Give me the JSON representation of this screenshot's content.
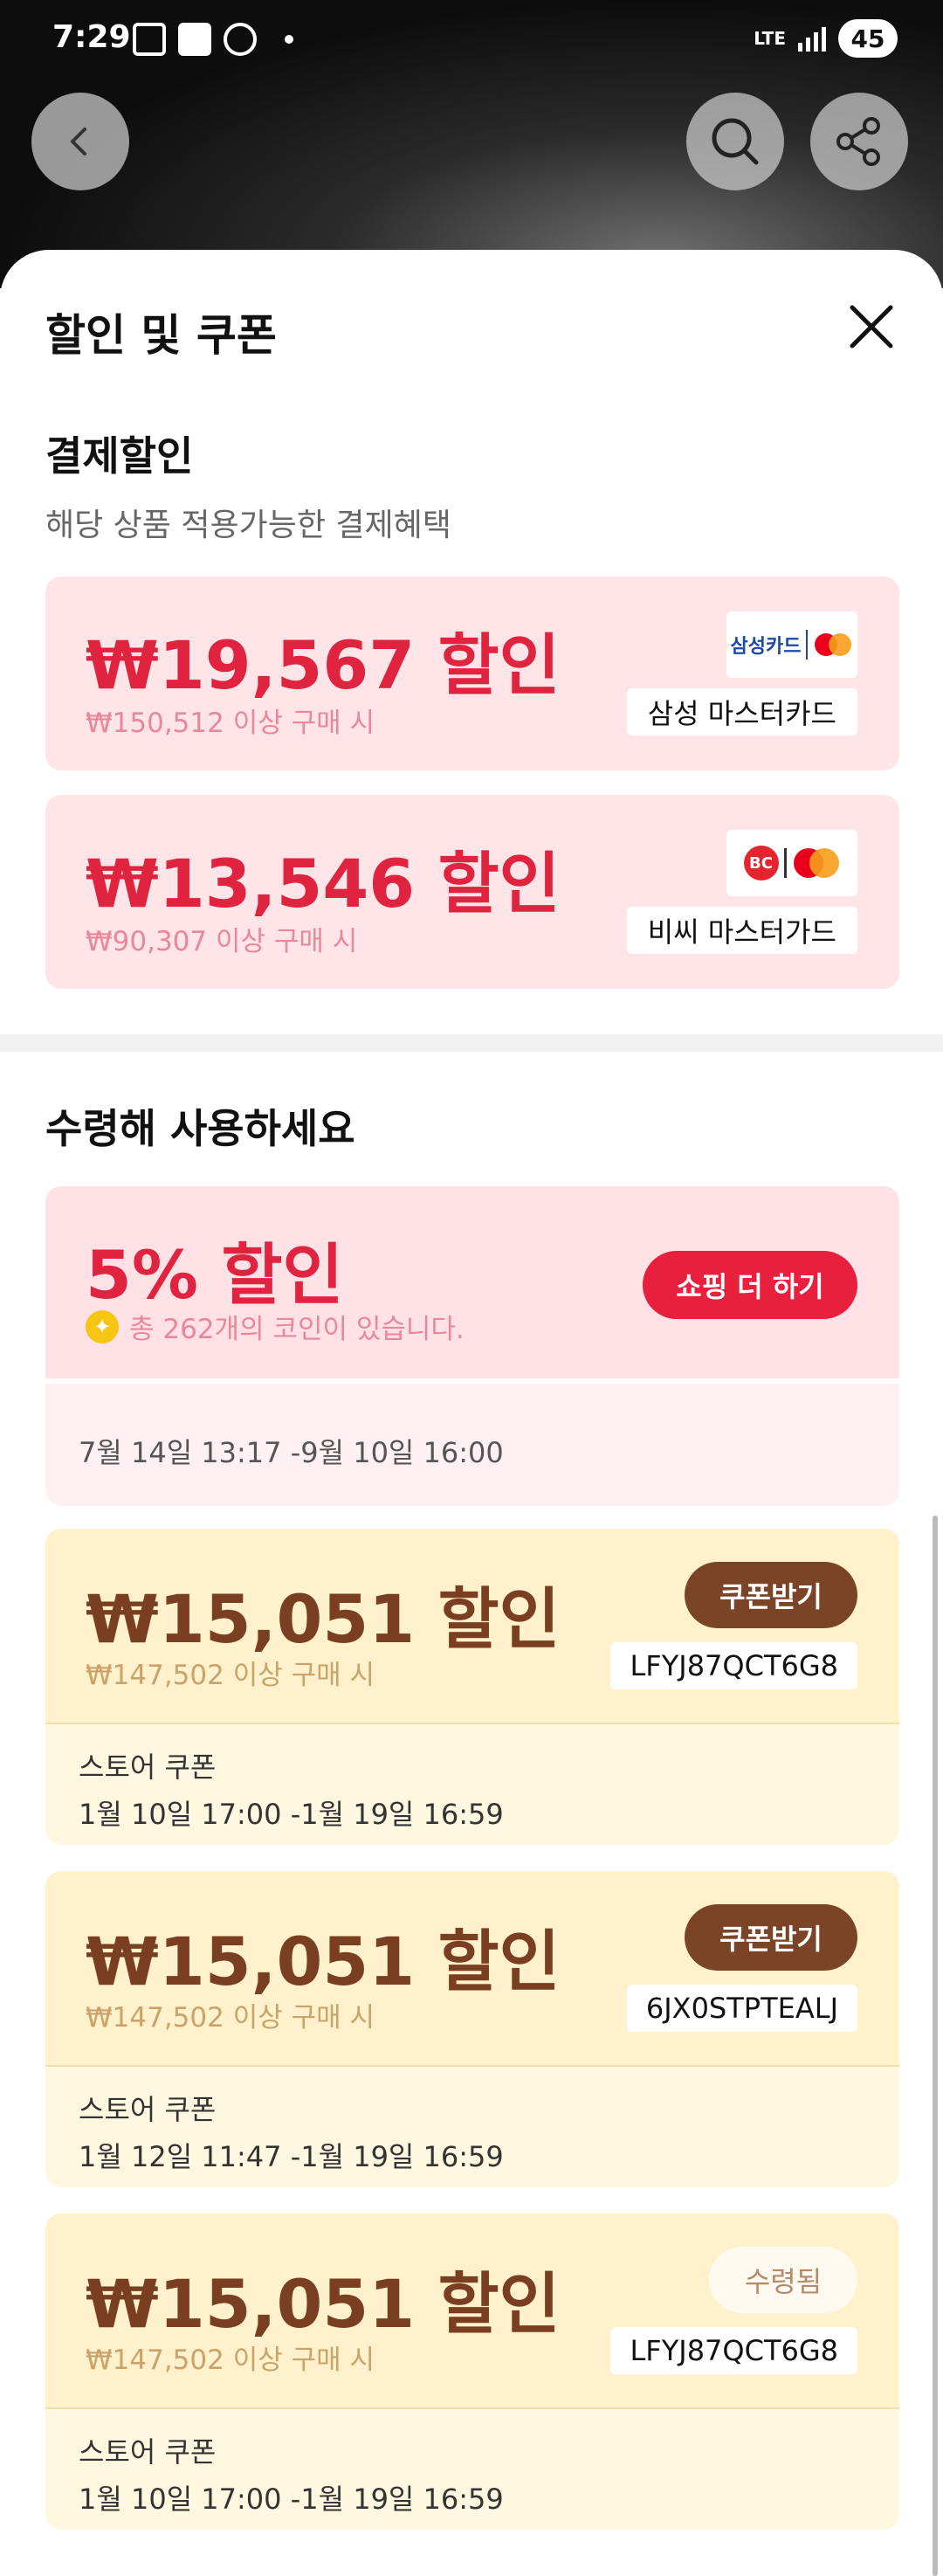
{
  "status_bar": {
    "time": "7:29",
    "network": "LTE",
    "battery": "45"
  },
  "sheet": {
    "title": "할인 및 쿠폰"
  },
  "payment": {
    "title": "결제할인",
    "subtitle": "해당 상품 적용가능한 결제혜택",
    "cards": [
      {
        "amount": "₩19,567 할인",
        "min": "₩150,512 이상 구매 시",
        "card": "삼성 마스터카드",
        "logo_text": "삼성카드"
      },
      {
        "amount": "₩13,546 할인",
        "min": "₩90,307 이상 구매 시",
        "card": "비씨 마스터가드",
        "logo_text": "BC"
      }
    ]
  },
  "coupons_section": {
    "title": "수령해 사용하세요"
  },
  "promo": {
    "amount": "5% 할인",
    "coins": "총 262개의 코인이 있습니다.",
    "button": "쇼핑 더 하기",
    "date": "7월 14일 13:17 -9월 10일 16:00"
  },
  "coupons": [
    {
      "amount": "₩15,051 할인",
      "min": "₩147,502 이상 구매 시",
      "button": "쿠폰받기",
      "code": "LFYJ87QCT6G8",
      "label": "스토어 쿠폰",
      "date": "1월 10일 17:00 -1월 19일 16:59"
    },
    {
      "amount": "₩15,051 할인",
      "min": "₩147,502 이상 구매 시",
      "button": "쿠폰받기",
      "code": "6JX0STPTEALJ",
      "label": "스토어 쿠폰",
      "date": "1월 12일 11:47 -1월 19일 16:59"
    },
    {
      "amount": "₩15,051 할인",
      "min": "₩147,502 이상 구매 시",
      "button": "수령됨",
      "code": "LFYJ87QCT6G8",
      "label": "스토어 쿠폰",
      "date": "1월 10일 17:00 -1월 19일 16:59"
    }
  ],
  "icons": {
    "back": "back-arrow-icon",
    "search": "search-icon",
    "share": "share-icon",
    "close": "close-icon",
    "coin": "coin-icon"
  },
  "colors": {
    "red": "#e0243f",
    "pink_bg": "#ffe4e8",
    "brown": "#7a3f22",
    "cream_bg": "#fff1cc"
  }
}
